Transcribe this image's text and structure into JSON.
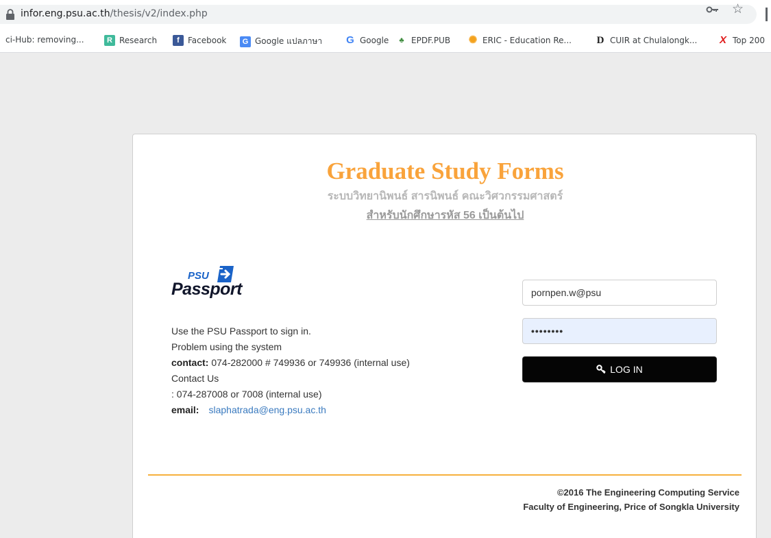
{
  "browser": {
    "url_host": "infor.eng.psu.ac.th",
    "url_path": "/thesis/v2/index.php",
    "bookmarks": [
      {
        "label": "ci-Hub: removing...",
        "icon": "scihub-icon"
      },
      {
        "label": "Research",
        "icon": "researchgate-icon"
      },
      {
        "label": "Facebook",
        "icon": "facebook-icon"
      },
      {
        "label": "Google แปลภาษา",
        "icon": "google-translate-icon"
      },
      {
        "label": "Google",
        "icon": "google-icon"
      },
      {
        "label": "EPDF.PUB",
        "icon": "epdf-icon"
      },
      {
        "label": "ERIC - Education Re...",
        "icon": "eric-icon"
      },
      {
        "label": "CUIR at Chulalongk...",
        "icon": "cuir-icon"
      },
      {
        "label": "Top 200",
        "icon": "x-icon"
      }
    ]
  },
  "header": {
    "title": "Graduate Study Forms",
    "subtitle": "ระบบวิทยานิพนธ์ สารนิพนธ์ คณะวิศวกรรมศาสตร์",
    "subtitle2": "สำหรับนักศึกษารหัส 56 เป็นต้นไป"
  },
  "logo": {
    "top": "PSU",
    "main": "Passport"
  },
  "info": {
    "line1": "Use the PSU Passport to sign in.",
    "line2": "Problem using the system",
    "contact_label": "contact:",
    "contact_value": " 074-282000 # 749936 or 749936 (internal use)",
    "line4": "Contact Us",
    "line5": ": 074-287008 or 7008 (internal use)",
    "email_label": "email:",
    "email_value": "slaphatrada@eng.psu.ac.th"
  },
  "form": {
    "username": "pornpen.w@psu",
    "password_mask": "••••••••",
    "login_label": "LOG IN"
  },
  "footer": {
    "line1": "©2016 The Engineering Computing Service",
    "line2": "Faculty of Engineering, Price of Songkla University"
  },
  "colors": {
    "title": "#f9a33b",
    "divider": "#f6b03c",
    "button": "#050505",
    "link": "#3a7abf"
  }
}
